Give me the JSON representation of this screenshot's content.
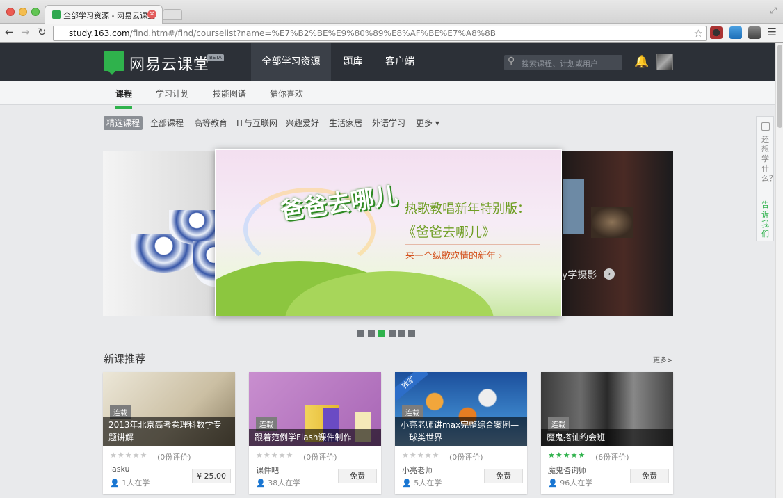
{
  "browser": {
    "tab_title": "全部学习资源 - 网易云课堂",
    "tab_close": "×",
    "url_host": "study.163.com",
    "url_path": "/find.htm#/find/courselist?name=%E7%B2%BE%E9%80%89%E8%AF%BE%E7%A8%8B",
    "back_icon": "arrow-left",
    "forward_icon": "arrow-right",
    "reload_icon": "reload",
    "star_icon": "star"
  },
  "site": {
    "logo_text": "网易云课堂",
    "beta": "BETA",
    "nav": [
      {
        "label": "全部学习资源",
        "active": true
      },
      {
        "label": "题库",
        "active": false
      },
      {
        "label": "客户端",
        "active": false
      }
    ],
    "search_placeholder": "搜索课程、计划或用户",
    "subnav": [
      {
        "label": "课程",
        "active": true
      },
      {
        "label": "学习计划",
        "active": false
      },
      {
        "label": "技能图谱",
        "active": false
      },
      {
        "label": "猜你喜欢",
        "active": false
      }
    ],
    "filters": [
      {
        "label": "精选课程",
        "active": true
      },
      {
        "label": "全部课程",
        "active": false
      },
      {
        "label": "高等教育",
        "active": false
      },
      {
        "label": "IT与互联网",
        "active": false
      },
      {
        "label": "兴趣爱好",
        "active": false
      },
      {
        "label": "生活家居",
        "active": false
      },
      {
        "label": "外语学习",
        "active": false
      },
      {
        "label": "更多 ▾",
        "active": false
      }
    ]
  },
  "carousel": {
    "art_title": "爸爸去哪儿",
    "headline": "热歌教唱新年特别版：",
    "subtitle": "《爸爸去哪儿》",
    "cta": "来一个纵歌欢情的新年  ›",
    "right_side_text": "y学摄影",
    "right_side_arrow": "›",
    "dot_count": 6,
    "active_dot": 2
  },
  "section": {
    "title": "新课推荐",
    "more": "更多>"
  },
  "courses": [
    {
      "badge": "连载",
      "title": "2013年北京高考卷理科数学专题讲解",
      "stars": "★★★★★",
      "review": "(0份评价)",
      "author": "iasku",
      "students": "1人在学",
      "price": "¥ 25.00",
      "exclusive": ""
    },
    {
      "badge": "连载",
      "title": "跟着范例学Flash课件制作",
      "stars": "★★★★★",
      "review": "(0份评价)",
      "author": "课件吧",
      "students": "38人在学",
      "price": "免费",
      "exclusive": ""
    },
    {
      "badge": "连载",
      "title": "小亮老师讲max完整综合案例—一球类世界",
      "stars": "★★★★★",
      "review": "(0份评价)",
      "author": "小亮老师",
      "students": "5人在学",
      "price": "免费",
      "exclusive": "独家"
    },
    {
      "badge": "连载",
      "title": "魔鬼搭讪约会班",
      "stars": "★★★★★",
      "review": "(6份评价)",
      "author": "魔鬼咨询师",
      "students": "96人在学",
      "price": "免费",
      "exclusive": ""
    }
  ],
  "feedback": {
    "text": "还想学什么？",
    "link": "告诉我们"
  },
  "colors": {
    "brand_green": "#2fb24c",
    "header_bg": "#2c3037"
  }
}
